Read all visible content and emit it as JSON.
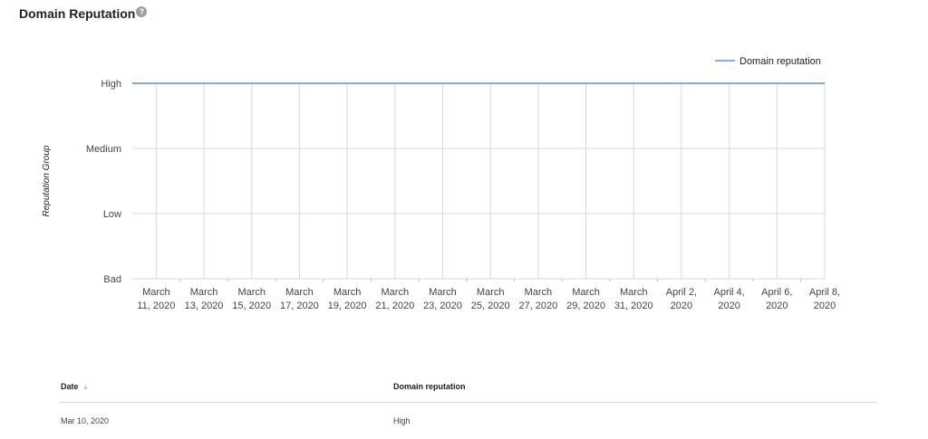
{
  "header": {
    "title": "Domain Reputation",
    "help_icon": "question-mark-icon"
  },
  "chart_data": {
    "type": "line",
    "title": "",
    "xlabel": "",
    "ylabel": "Reputation Group",
    "y_categories": [
      "Bad",
      "Low",
      "Medium",
      "High"
    ],
    "x_tick_labels": [
      [
        "March",
        "11, 2020"
      ],
      [
        "March",
        "13, 2020"
      ],
      [
        "March",
        "15, 2020"
      ],
      [
        "March",
        "17, 2020"
      ],
      [
        "March",
        "19, 2020"
      ],
      [
        "March",
        "21, 2020"
      ],
      [
        "March",
        "23, 2020"
      ],
      [
        "March",
        "25, 2020"
      ],
      [
        "March",
        "27, 2020"
      ],
      [
        "March",
        "29, 2020"
      ],
      [
        "March",
        "31, 2020"
      ],
      [
        "April 2,",
        "2020"
      ],
      [
        "April 4,",
        "2020"
      ],
      [
        "April 6,",
        "2020"
      ],
      [
        "April 8,",
        "2020"
      ]
    ],
    "x": [
      "2020-03-10",
      "2020-03-11",
      "2020-03-12",
      "2020-03-13",
      "2020-03-14",
      "2020-03-15",
      "2020-03-16",
      "2020-03-17",
      "2020-03-18",
      "2020-03-19",
      "2020-03-20",
      "2020-03-21",
      "2020-03-22",
      "2020-03-23",
      "2020-03-24",
      "2020-03-25",
      "2020-03-26",
      "2020-03-27",
      "2020-03-28",
      "2020-03-29",
      "2020-03-30",
      "2020-03-31",
      "2020-04-01",
      "2020-04-02",
      "2020-04-03",
      "2020-04-04",
      "2020-04-05",
      "2020-04-06",
      "2020-04-07",
      "2020-04-08"
    ],
    "series": [
      {
        "name": "Domain reputation",
        "color": "#5b8def",
        "values": [
          "High",
          "High",
          "High",
          "High",
          "High",
          "High",
          "High",
          "High",
          "High",
          "High",
          "High",
          "High",
          "High",
          "High",
          "High",
          "High",
          "High",
          "High",
          "High",
          "High",
          "High",
          "High",
          "High",
          "High",
          "High",
          "High",
          "High",
          "High",
          "High",
          "High"
        ]
      }
    ],
    "grid": true,
    "legend": "top-right"
  },
  "table": {
    "columns": [
      "Date",
      "Domain reputation"
    ],
    "sort_indicator": "▲",
    "rows": [
      [
        "Mar 10, 2020",
        "High"
      ]
    ]
  }
}
